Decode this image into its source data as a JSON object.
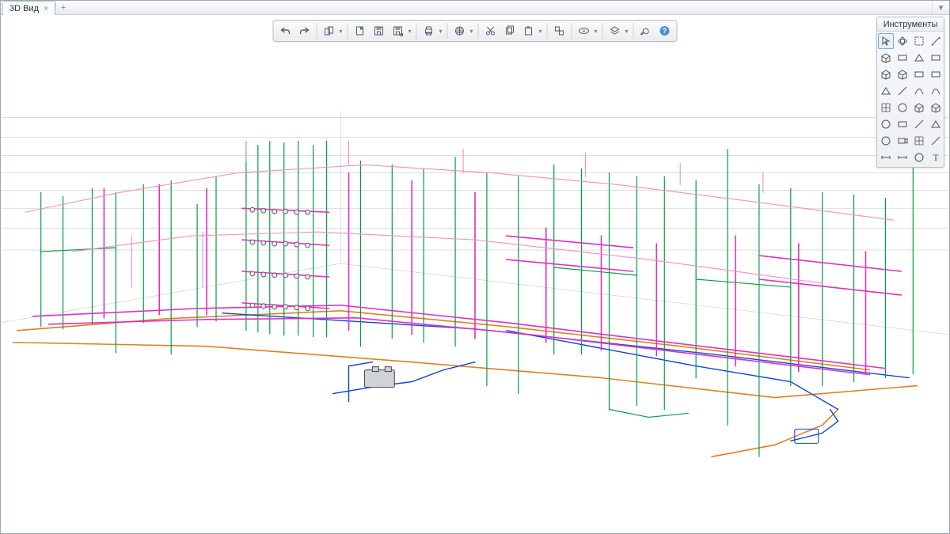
{
  "tabs": {
    "active_label": "3D Вид",
    "close_symbol": "×",
    "add_symbol": "+",
    "expand_symbol": "▾"
  },
  "toolbar": {
    "buttons": [
      {
        "name": "undo",
        "icon": "undo"
      },
      {
        "name": "redo",
        "icon": "redo"
      },
      {
        "sep": true
      },
      {
        "name": "copy-props",
        "icon": "copyprops",
        "dropdown": true
      },
      {
        "sep": true
      },
      {
        "name": "new",
        "icon": "new"
      },
      {
        "name": "save",
        "icon": "save"
      },
      {
        "name": "saveas",
        "icon": "saveas",
        "dropdown": true
      },
      {
        "sep": true
      },
      {
        "name": "print",
        "icon": "print",
        "dropdown": true
      },
      {
        "sep": true
      },
      {
        "name": "publish",
        "icon": "publish",
        "dropdown": true
      },
      {
        "sep": true
      },
      {
        "name": "cut",
        "icon": "cut"
      },
      {
        "name": "copy",
        "icon": "copy"
      },
      {
        "name": "paste",
        "icon": "paste",
        "dropdown": true
      },
      {
        "sep": true
      },
      {
        "name": "link",
        "icon": "link"
      },
      {
        "sep": true
      },
      {
        "name": "visibility",
        "icon": "eye",
        "dropdown": true
      },
      {
        "sep": true
      },
      {
        "name": "layers",
        "icon": "layers",
        "dropdown": true
      },
      {
        "sep": true
      },
      {
        "name": "settings",
        "icon": "wrench"
      },
      {
        "name": "help",
        "icon": "help"
      }
    ]
  },
  "palette": {
    "title": "Инструменты",
    "tools": [
      {
        "name": "pointer",
        "selected": true
      },
      {
        "name": "orbit"
      },
      {
        "name": "marquee"
      },
      {
        "name": "measure"
      },
      {
        "name": "wall"
      },
      {
        "name": "slab"
      },
      {
        "name": "roof"
      },
      {
        "name": "beam"
      },
      {
        "name": "column"
      },
      {
        "name": "shape"
      },
      {
        "name": "door"
      },
      {
        "name": "window"
      },
      {
        "name": "stair"
      },
      {
        "name": "line"
      },
      {
        "name": "curve"
      },
      {
        "name": "spline"
      },
      {
        "name": "mesh"
      },
      {
        "name": "morph"
      },
      {
        "name": "shell"
      },
      {
        "name": "object"
      },
      {
        "name": "lamp"
      },
      {
        "name": "zone"
      },
      {
        "name": "section"
      },
      {
        "name": "elevation"
      },
      {
        "name": "detail"
      },
      {
        "name": "camera"
      },
      {
        "name": "grid"
      },
      {
        "name": "level"
      },
      {
        "name": "dim"
      },
      {
        "name": "angle"
      },
      {
        "name": "radial"
      },
      {
        "name": "text"
      }
    ]
  },
  "colors": {
    "pipe_magenta": "#e030c0",
    "pipe_green": "#00a040",
    "pipe_blue": "#1040e0",
    "pipe_orange": "#e08020",
    "pipe_pink": "#f090c0",
    "grid": "#9aa0a6"
  }
}
